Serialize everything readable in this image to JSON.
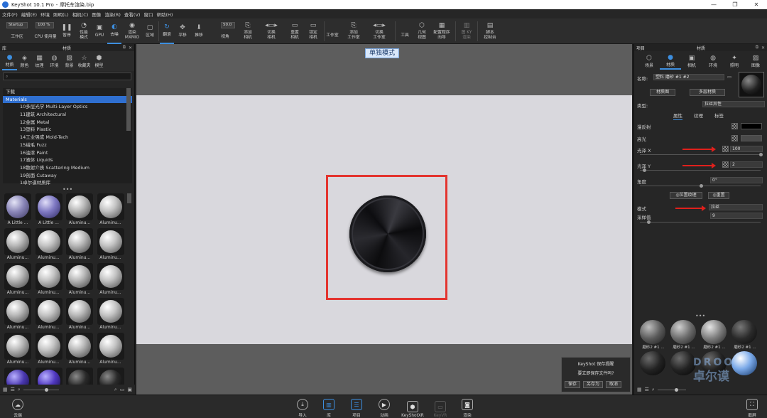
{
  "title": {
    "app": "KeyShot 10.1 Pro",
    "file": "摩托车渲染.bip"
  },
  "menu": [
    "文件(F)",
    "编辑(E)",
    "环境",
    "照明(L)",
    "相机(C)",
    "图像",
    "渲染(R)",
    "查看(V)",
    "窗口",
    "帮助(H)"
  ],
  "toolbar": {
    "workspace_value": "Startup",
    "workspace_label": "工作区",
    "cpu_value": "100 %",
    "cpu_label": "CPU 使用量",
    "pause": "暂停",
    "perf_mode": [
      "性能",
      "模式"
    ],
    "gpu": "GPU",
    "denoise": "去噪",
    "render_mode": [
      "渲染",
      "MXMIO"
    ],
    "region": "区域",
    "tumble": "翻滚",
    "pan": "平移",
    "dolly": "推移",
    "fov_value": "50.0",
    "fov_label": "视角",
    "add_camera": [
      "添加",
      "相机"
    ],
    "switch_camera": [
      "切换",
      "相机"
    ],
    "reset_camera": [
      "重置",
      "相机"
    ],
    "lock_camera": [
      "锁定",
      "相机"
    ],
    "studio": "工作室",
    "add_studio": [
      "添加",
      "工作室"
    ],
    "switch_studio": [
      "切换",
      "工作室"
    ],
    "tools": "工具",
    "geometry_view": [
      "几何",
      "视图"
    ],
    "config_wizard": [
      "配置程序",
      "向导"
    ],
    "vr": [
      "图 KY",
      "渲染"
    ],
    "script_console": [
      "脚本",
      "控制台"
    ]
  },
  "library": {
    "title": "库",
    "panel_title": "材质",
    "tabs": [
      "材质",
      "颜色",
      "纹理",
      "环境",
      "背景",
      "收藏夹",
      "模型"
    ],
    "tree": [
      {
        "label": "下载",
        "indent": false,
        "selected": false
      },
      {
        "label": "Materials",
        "indent": false,
        "selected": true
      },
      {
        "label": "10多层光学 Multi-Layer Optics",
        "indent": true,
        "selected": false
      },
      {
        "label": "11建筑 Architectural",
        "indent": true,
        "selected": false
      },
      {
        "label": "12金属 Metal",
        "indent": true,
        "selected": false
      },
      {
        "label": "13塑料 Plastic",
        "indent": true,
        "selected": false
      },
      {
        "label": "14工业强成 Mold-Tech",
        "indent": true,
        "selected": false
      },
      {
        "label": "15绒毛 Fuzz",
        "indent": true,
        "selected": false
      },
      {
        "label": "16油漆 Paint",
        "indent": true,
        "selected": false
      },
      {
        "label": "17液体 Liquids",
        "indent": true,
        "selected": false
      },
      {
        "label": "18散射介质 Scattering Medium",
        "indent": true,
        "selected": false
      },
      {
        "label": "19剖面 Cutaway",
        "indent": true,
        "selected": false
      },
      {
        "label": "1卓尔谟材质库",
        "indent": true,
        "selected": false
      }
    ],
    "thumbs": [
      "A Little ...",
      "A Little ...",
      "Aluminu...",
      "Aluminu...",
      "Aluminu...",
      "Aluminu...",
      "Aluminu...",
      "Aluminu...",
      "Aluminu...",
      "Aluminu...",
      "Aluminu...",
      "Aluminu...",
      "Aluminu...",
      "Aluminu...",
      "Aluminu...",
      "Aluminu...",
      "Aluminu...",
      "Aluminu...",
      "Aluminu...",
      "Aluminu...",
      "",
      "",
      "",
      ""
    ]
  },
  "viewport": {
    "mode_badge": "单独模式",
    "dialog_title": "KeyShot 保存提醒",
    "dialog_question": "要立即保存文件吗?",
    "dialog_buttons": [
      "保存",
      "另存为",
      "取消"
    ]
  },
  "project": {
    "title": "项目",
    "panel_title": "材质",
    "tabs": [
      "场景",
      "材质",
      "相机",
      "环境",
      "照明",
      "图像"
    ],
    "name_label": "名称:",
    "name_value": "塑料 磨砂 #1 #2",
    "btn_graph": "材质图",
    "btn_multi": "多层材质",
    "type_label": "类型:",
    "type_value": "拉丝异性",
    "subtabs": [
      "属性",
      "纹理",
      "标签"
    ],
    "diffuse": "漫反射",
    "specular": "高光",
    "roughness_x": "光泽 X",
    "roughness_x_value": "100",
    "roughness_y": "光泽 Y",
    "roughness_y_value": "2",
    "angle": "角度",
    "angle_value": "0°",
    "btn_pos_tex": "位置纹理",
    "btn_reset": "重置",
    "mode_label": "模式",
    "mode_value": "拉丝",
    "samples_label": "采样值",
    "samples_value": "9",
    "thumbs": [
      "磨砂2 #1 ...",
      "磨砂2 #1 ...",
      "磨砂2 #1 ...",
      "磨砂2 #1 ...",
      "",
      "",
      "",
      ""
    ]
  },
  "bottom": {
    "cloud": "云端",
    "items": [
      "导入",
      "库",
      "项目",
      "动画",
      "KeyShotXR",
      "KeyVR",
      "渲染"
    ],
    "screenshot": "截屏"
  },
  "watermark": [
    "DROO",
    "卓尔谟"
  ],
  "colors": {
    "accent": "#3d8fe0",
    "annotation_red": "#e3342f",
    "selection": "#2f6fd0"
  }
}
